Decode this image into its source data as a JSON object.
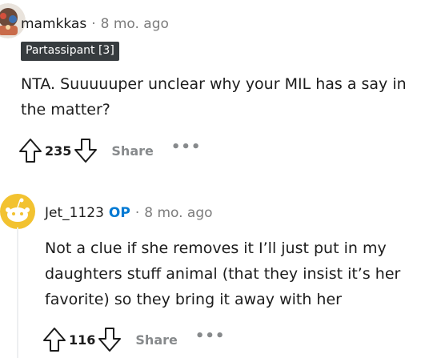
{
  "comments": [
    {
      "username": "mamkkas",
      "separator": "·",
      "time": "8 mo. ago",
      "flair": "Partassipant [3]",
      "body": "NTA. Suuuuuper unclear why your MIL has a say in the matter?",
      "score": "235",
      "share_label": "Share",
      "more_label": "•••"
    },
    {
      "username": "Jet_1123",
      "op_badge": "OP",
      "separator": "·",
      "time": "8 mo. ago",
      "body": "Not a clue if she removes it I’ll just put in my daughters stuff animal (that they insist it’s her favorite) so they bring it away with her",
      "score": "116",
      "share_label": "Share",
      "more_label": "•••"
    }
  ],
  "colors": {
    "op_blue": "#0079d3",
    "flair_bg": "#373c3f",
    "meta_gray": "#7c7c7c",
    "action_gray": "#878a8c",
    "snoo_yellow": "#f2c230"
  }
}
